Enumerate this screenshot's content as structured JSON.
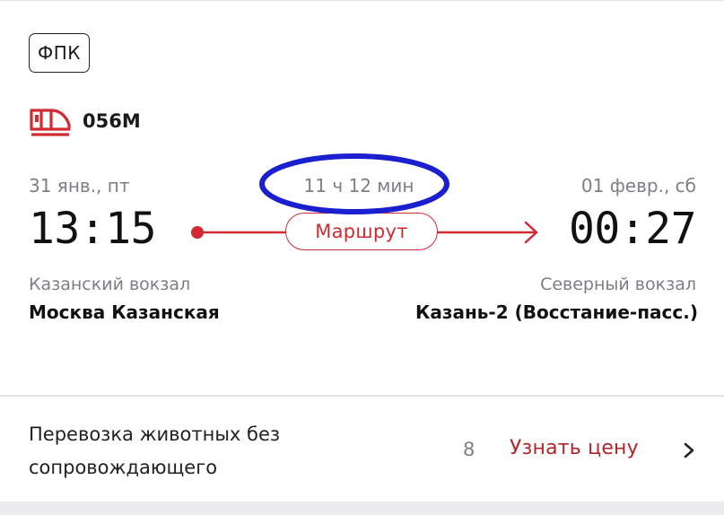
{
  "carrier": {
    "badge": "ФПК"
  },
  "train": {
    "number": "056М",
    "icon": "train-icon"
  },
  "departure": {
    "date": "31 янв., пт",
    "time": "13:15",
    "station": "Казанский вокзал",
    "city": "Москва Казанская"
  },
  "arrival": {
    "date": "01 февр., сб",
    "time": "00:27",
    "station": "Северный вокзал",
    "city": "Казань-2 (Восстание-пасс.)"
  },
  "route": {
    "duration": "11 ч 12 мин",
    "button_label": "Маршрут"
  },
  "service": {
    "name": "Перевозка животных без сопровождающего",
    "count": "8",
    "link_label": "Узнать цену",
    "chevron": "chevron-right-icon"
  },
  "colors": {
    "accent_red": "#d12a32",
    "link_red": "#b3242c",
    "muted_gray": "#7d7f85",
    "annotation_blue": "#1a1fd0"
  }
}
